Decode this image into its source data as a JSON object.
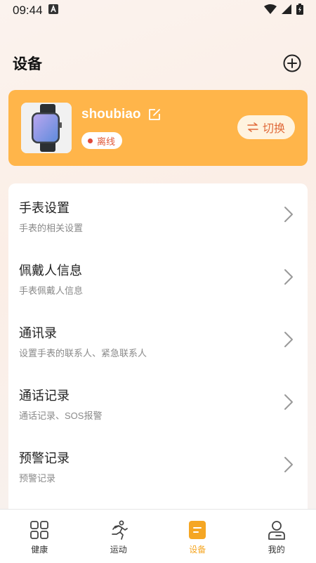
{
  "status_bar": {
    "time": "09:44"
  },
  "header": {
    "title": "设备"
  },
  "device": {
    "name": "shoubiao",
    "status": "离线",
    "switch_label": "切换"
  },
  "settings": [
    {
      "title": "手表设置",
      "subtitle": "手表的相关设置"
    },
    {
      "title": "佩戴人信息",
      "subtitle": "手表佩戴人信息"
    },
    {
      "title": "通讯录",
      "subtitle": "设置手表的联系人、紧急联系人"
    },
    {
      "title": "通话记录",
      "subtitle": "通话记录、SOS报警"
    },
    {
      "title": "预警记录",
      "subtitle": "预警记录"
    }
  ],
  "tabs": [
    {
      "label": "健康",
      "icon": "grid-icon"
    },
    {
      "label": "运动",
      "icon": "running-icon"
    },
    {
      "label": "设备",
      "icon": "device-icon",
      "active": true
    },
    {
      "label": "我的",
      "icon": "profile-icon"
    }
  ],
  "colors": {
    "accent": "#ffb54a",
    "active_tab": "#f5a623",
    "offline": "#e0493a"
  }
}
